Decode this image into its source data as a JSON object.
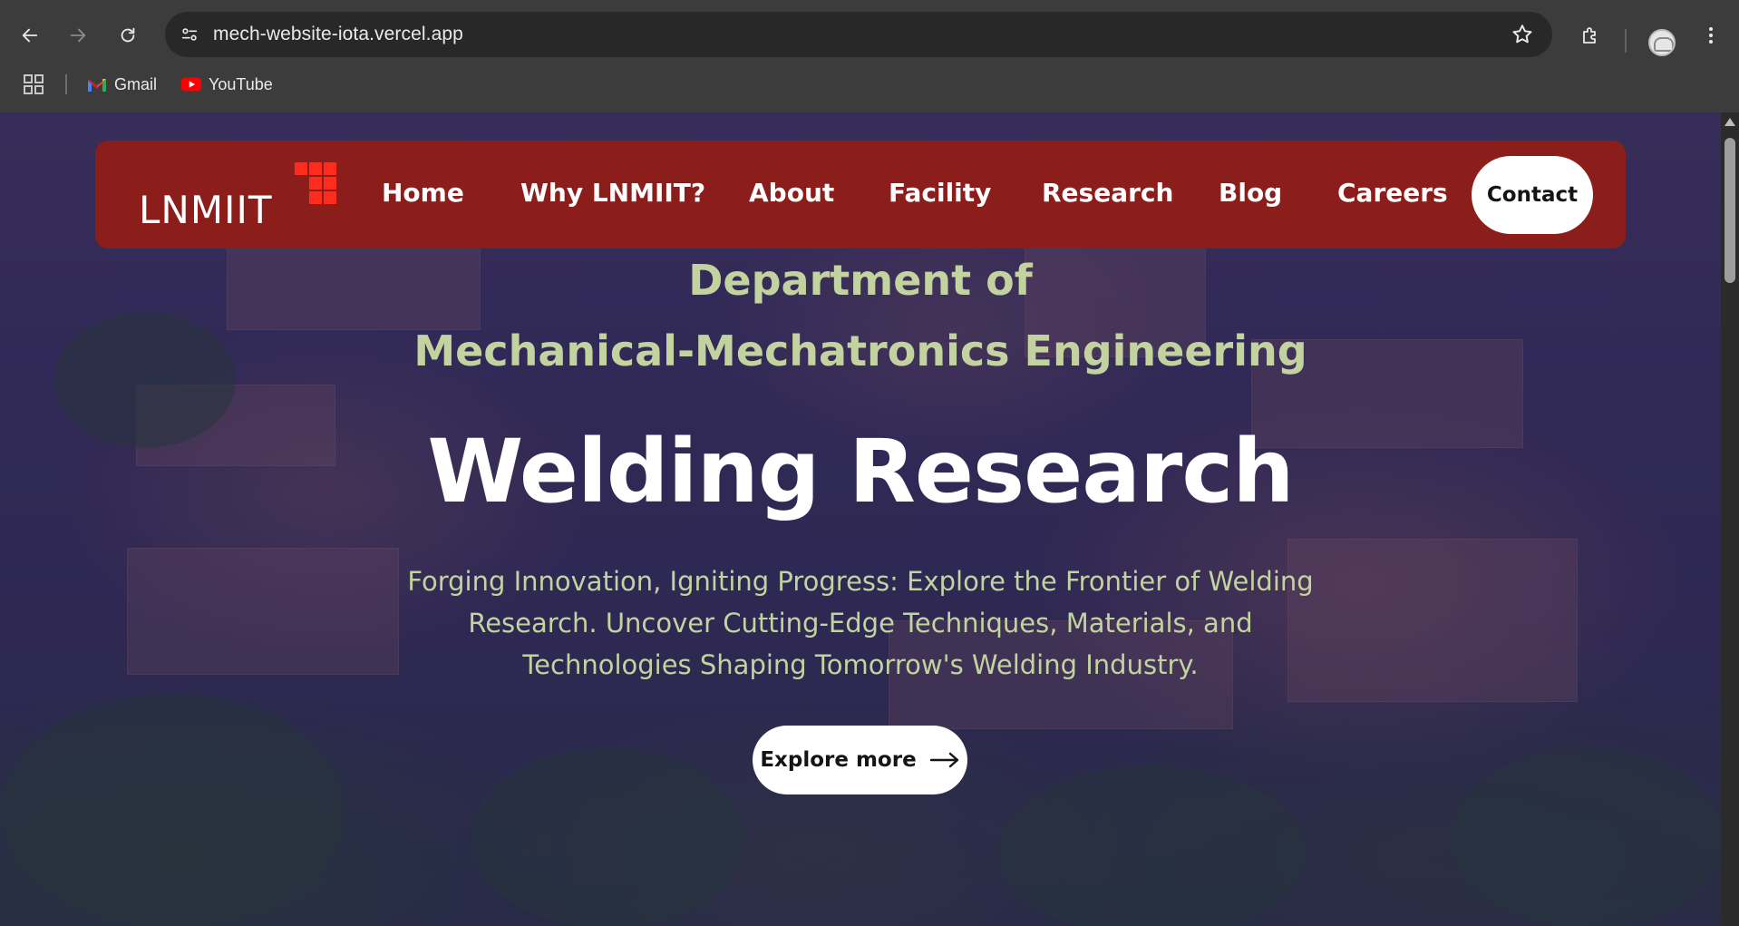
{
  "browser": {
    "url": "mech-website-iota.vercel.app",
    "bookmarks": [
      {
        "label": "Gmail",
        "icon": "gmail-icon"
      },
      {
        "label": "YouTube",
        "icon": "youtube-icon"
      }
    ]
  },
  "site": {
    "logo_text": "LNMIIT",
    "nav": {
      "home": "Home",
      "why": "Why LNMIIT?",
      "about": "About",
      "facility": "Facility",
      "research": "Research",
      "blog": "Blog",
      "careers": "Careers",
      "contact": "Contact"
    },
    "colors": {
      "nav_bg": "#8b1d1b",
      "logo_accent": "#ff2b1c",
      "heading_green": "#c2d3a0"
    }
  },
  "hero": {
    "dept_line1": "Department of",
    "dept_line2": "Mechanical-Mechatronics Engineering",
    "title": "Welding Research",
    "subtitle": "Forging Innovation, Igniting Progress: Explore the Frontier of Welding Research. Uncover Cutting-Edge Techniques, Materials, and Technologies Shaping Tomorrow's Welding Industry.",
    "cta": "Explore more"
  }
}
